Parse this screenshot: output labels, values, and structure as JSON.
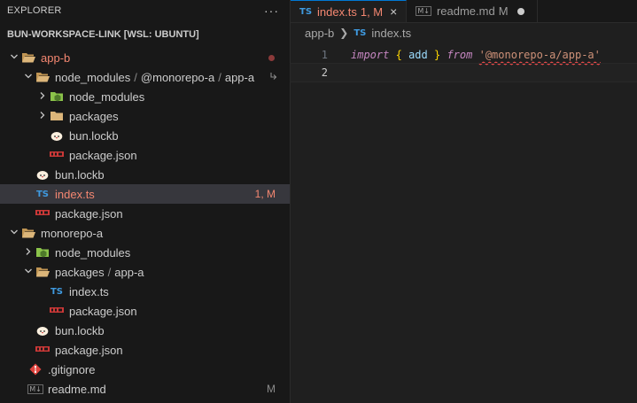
{
  "sidebar": {
    "title": "EXPLORER",
    "more": "···",
    "workspace": "BUN-WORKSPACE-LINK [WSL: UBUNTU]",
    "tree": [
      {
        "label": "app-b",
        "red": true,
        "twisty": "open",
        "icon": "folder-open",
        "indent": 0,
        "marker": "dot"
      },
      {
        "label": "node_modules",
        "path2": "@monorepo-a",
        "path3": "app-a",
        "twisty": "open",
        "icon": "folder-open",
        "indent": 1,
        "marker": "link"
      },
      {
        "label": "node_modules",
        "twisty": "closed",
        "icon": "folder-node",
        "indent": 2
      },
      {
        "label": "packages",
        "twisty": "closed",
        "icon": "folder",
        "indent": 2
      },
      {
        "label": "bun.lockb",
        "icon": "bun",
        "indent": 2
      },
      {
        "label": "package.json",
        "icon": "npm",
        "indent": 2
      },
      {
        "label": "bun.lockb",
        "icon": "bun",
        "indent": 1
      },
      {
        "label": "index.ts",
        "red": true,
        "icon": "ts",
        "indent": 1,
        "selected": true,
        "badge": "1, M"
      },
      {
        "label": "package.json",
        "icon": "npm",
        "indent": 1
      },
      {
        "label": "monorepo-a",
        "twisty": "open",
        "icon": "folder-open",
        "indent": 0
      },
      {
        "label": "node_modules",
        "twisty": "closed",
        "icon": "folder-node",
        "indent": 1
      },
      {
        "label": "packages",
        "path2": "app-a",
        "twisty": "open",
        "icon": "folder-open",
        "indent": 1
      },
      {
        "label": "index.ts",
        "icon": "ts",
        "indent": 2
      },
      {
        "label": "package.json",
        "icon": "npm",
        "indent": 2
      },
      {
        "label": "bun.lockb",
        "icon": "bun",
        "indent": 1
      },
      {
        "label": "package.json",
        "icon": "npm",
        "indent": 1
      },
      {
        "label": ".gitignore",
        "icon": "git",
        "indent": 0.5
      },
      {
        "label": "readme.md",
        "icon": "md",
        "indent": 0.5,
        "badge": "M",
        "badgeGray": true
      }
    ]
  },
  "tabs": [
    {
      "icon": "TS",
      "label": "index.ts",
      "status": "1, M",
      "active": true,
      "close": "×"
    },
    {
      "icon": "M↓",
      "label": "readme.md",
      "status": "M",
      "active": false
    }
  ],
  "breadcrumb": {
    "folder": "app-b",
    "icon": "TS",
    "file": "index.ts"
  },
  "code": {
    "line1_no": "1",
    "line2_no": "2",
    "kw_import": "import",
    "brace_open": "{",
    "ident": "add",
    "brace_close": "}",
    "kw_from": "from",
    "module": "'@monorepo-a/app-a'"
  },
  "colors": {
    "accent": "#0078d4",
    "error": "#f48771",
    "ts": "#3f9ae0"
  }
}
